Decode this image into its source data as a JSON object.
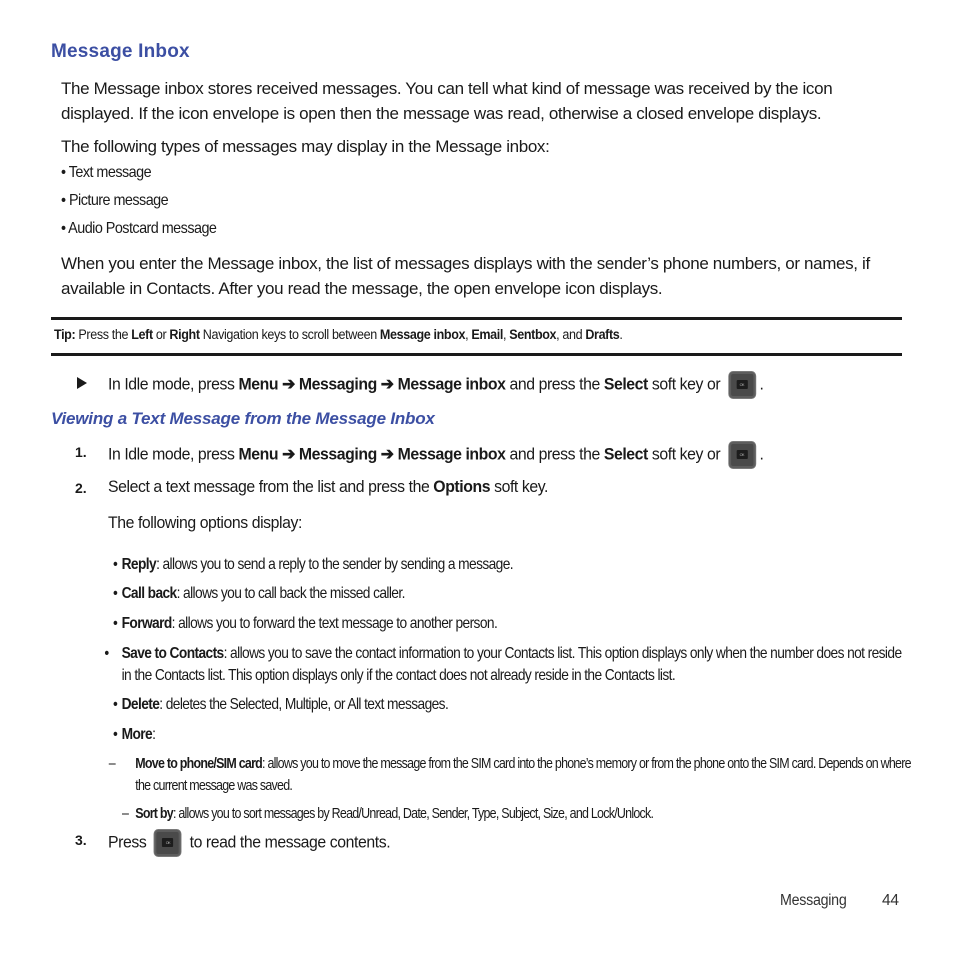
{
  "section": {
    "title": "Message Inbox",
    "intro": "The Message inbox stores received messages. You can tell what kind of message was received by the icon displayed. If the icon envelope is open then the message was read, otherwise a closed envelope displays.",
    "types_intro": "The following types of messages may display in the Message inbox:",
    "types": [
      "Text message",
      "Picture message",
      "Audio Postcard message"
    ],
    "enter_text": "When you enter the Message inbox, the list of messages displays with the sender’s phone numbers, or names, if available in Contacts. After you read the message, the open envelope icon displays."
  },
  "tip": {
    "label": "Tip:",
    "t1": " Press the ",
    "left": "Left",
    "t2": " or ",
    "right": "Right",
    "t3": " Navigation keys to scroll between ",
    "inbox": "Message inbox",
    "c1": ", ",
    "email": "Email",
    "c2": ", ",
    "sentbox": "Sentbox",
    "t4": ", and ",
    "drafts": "Drafts",
    "end": "."
  },
  "path_step": {
    "t1": "In Idle mode, press ",
    "menu": "Menu",
    "arrow": " ➔ ",
    "messaging": "Messaging",
    "inbox": "Message inbox",
    "t2": " and press the ",
    "select": "Select",
    "t3": " soft key or ",
    "end": ".",
    "ok_label": "OK"
  },
  "subsection": {
    "title": "Viewing a Text Message from the Message Inbox",
    "steps": [
      {
        "num": "1."
      },
      {
        "num": "2.",
        "t1": "Select a text message from the list and press the ",
        "bold": "Options",
        "t2": " soft key.",
        "note": "The following options display:"
      },
      {
        "num": "3.",
        "t1": "Press ",
        "t2": " to read the message contents."
      }
    ],
    "options": [
      {
        "name": "Reply",
        "desc": ": allows you to send a reply to the sender by sending a message."
      },
      {
        "name": "Call back",
        "desc": ": allows you to call back the missed caller."
      },
      {
        "name": "Forward",
        "desc": ": allows you to forward the text message to another person."
      },
      {
        "name": "Save to Contacts",
        "desc": ": allows you to save the contact information to your Contacts list. This option displays only when the number does not reside in the Contacts list. This option displays only if the contact does not already reside in the Contacts list."
      },
      {
        "name": "Delete",
        "desc": ": deletes the Selected, Multiple, or All text messages."
      },
      {
        "name": "More",
        "desc": ":"
      }
    ],
    "more_options": [
      {
        "name": "Move to phone/SIM card",
        "desc": ": allows you to move the message from the SIM card into the phone’s memory or from the phone onto the SIM card. Depends on where the current message was saved."
      },
      {
        "name": "Sort by",
        "desc": ": allows you to sort messages by Read/Unread, Date, Sender, Type, Subject, Size, and Lock/Unlock."
      }
    ]
  },
  "footer": {
    "chapter": "Messaging",
    "page": "44"
  },
  "colors": {
    "heading": "#3c4fa3",
    "text": "#1a1a1a"
  }
}
